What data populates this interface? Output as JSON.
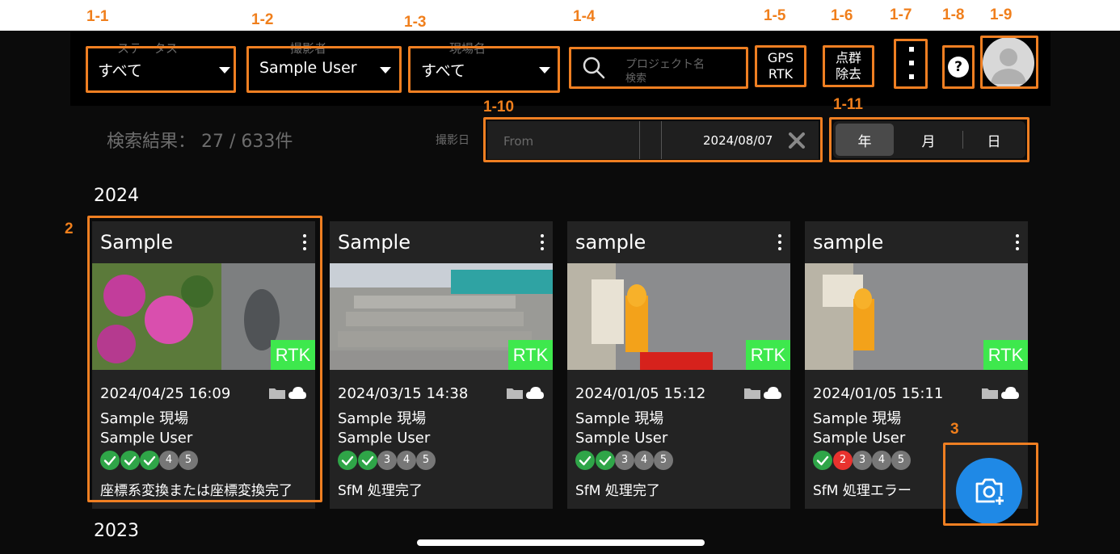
{
  "annotations": {
    "a1_1": "1-1",
    "a1_2": "1-2",
    "a1_3": "1-3",
    "a1_4": "1-4",
    "a1_5": "1-5",
    "a1_6": "1-6",
    "a1_7": "1-7",
    "a1_8": "1-8",
    "a1_9": "1-9",
    "a1_10": "1-10",
    "a1_11": "1-11",
    "a2": "2",
    "a3": "3"
  },
  "filters": {
    "status": {
      "label": "ステータス",
      "value": "すべて"
    },
    "photographer": {
      "label": "撮影者",
      "value": "Sample User"
    },
    "site": {
      "label": "現場名",
      "value": "すべて"
    }
  },
  "search": {
    "placeholder_line1": "プロジェクト名",
    "placeholder_line2": "検索"
  },
  "buttons": {
    "gps_line1": "GPS",
    "gps_line2": "RTK",
    "pc_line1": "点群",
    "pc_line2": "除去",
    "help": "?"
  },
  "results": {
    "text": "検索結果： 27 / 633件"
  },
  "date_filter": {
    "label": "撮影日",
    "from_placeholder": "From",
    "to_value": "2024/08/07"
  },
  "granularity": {
    "year": "年",
    "month": "月",
    "day": "日",
    "selected": "year"
  },
  "groups": [
    {
      "year": "2024"
    },
    {
      "year": "2023"
    }
  ],
  "cards": [
    {
      "title": "Sample",
      "badge": "RTK",
      "datetime": "2024/04/25 16:09",
      "site": "Sample 現場",
      "user": "Sample User",
      "steps": [
        {
          "label": "",
          "state": "done"
        },
        {
          "label": "",
          "state": "done"
        },
        {
          "label": "",
          "state": "done"
        },
        {
          "label": "4",
          "state": "pending"
        },
        {
          "label": "5",
          "state": "pending"
        }
      ],
      "status": "座標系変換または座標変換完了"
    },
    {
      "title": "Sample",
      "badge": "RTK",
      "datetime": "2024/03/15 14:38",
      "site": "Sample 現場",
      "user": "Sample User",
      "steps": [
        {
          "label": "",
          "state": "done"
        },
        {
          "label": "",
          "state": "done"
        },
        {
          "label": "3",
          "state": "pending"
        },
        {
          "label": "4",
          "state": "pending"
        },
        {
          "label": "5",
          "state": "pending"
        }
      ],
      "status": "SfM 処理完了"
    },
    {
      "title": "sample",
      "badge": "RTK",
      "datetime": "2024/01/05 15:12",
      "site": "Sample 現場",
      "user": "Sample User",
      "steps": [
        {
          "label": "",
          "state": "done"
        },
        {
          "label": "",
          "state": "done"
        },
        {
          "label": "3",
          "state": "pending"
        },
        {
          "label": "4",
          "state": "pending"
        },
        {
          "label": "5",
          "state": "pending"
        }
      ],
      "status": "SfM 処理完了"
    },
    {
      "title": "sample",
      "badge": "RTK",
      "datetime": "2024/01/05 15:11",
      "site": "Sample 現場",
      "user": "Sample User",
      "steps": [
        {
          "label": "",
          "state": "done"
        },
        {
          "label": "2",
          "state": "error"
        },
        {
          "label": "3",
          "state": "pending"
        },
        {
          "label": "4",
          "state": "pending"
        },
        {
          "label": "5",
          "state": "pending"
        }
      ],
      "status": "SfM 処理エラー"
    }
  ],
  "colors": {
    "annotation": "#f07f1c",
    "done": "#2fa548",
    "error": "#e8322e",
    "pending": "#777777",
    "rtk": "#3ee84d",
    "fab": "#1f89e6"
  },
  "icons": {
    "search": "search-icon",
    "folder": "folder-icon",
    "cloud": "cloud-icon",
    "camera_add": "camera-add-icon",
    "clear": "clear-icon",
    "more": "more-vertical-icon"
  }
}
